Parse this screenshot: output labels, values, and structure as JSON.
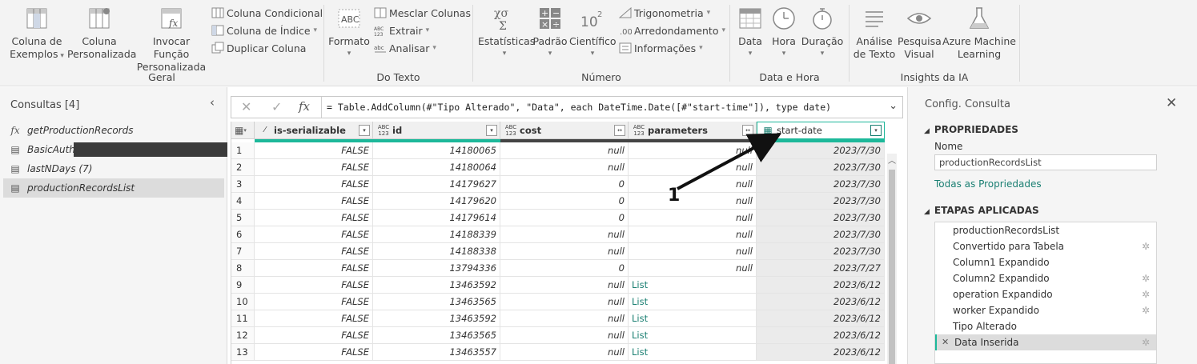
{
  "ribbon": {
    "groups": {
      "geral": "Geral",
      "texto": "Do Texto",
      "numero": "Número",
      "datahora": "Data e Hora",
      "ia": "Insights da IA"
    },
    "buttons": {
      "coluna_exemplos_1": "Coluna de",
      "coluna_exemplos_2": "Exemplos",
      "coluna_personalizada_1": "Coluna",
      "coluna_personalizada_2": "Personalizada",
      "invocar_1": "Invocar Função",
      "invocar_2": "Personalizada",
      "coluna_condicional": "Coluna Condicional",
      "coluna_indice": "Coluna de Índice",
      "duplicar_coluna": "Duplicar Coluna",
      "formato": "Formato",
      "mesclar": "Mesclar Colunas",
      "extrair": "Extrair",
      "analisar": "Analisar",
      "estatisticas": "Estatísticas",
      "padrao": "Padrão",
      "cientifico": "Científico",
      "trigonometria": "Trigonometria",
      "arredondamento": "Arredondamento",
      "informacoes": "Informações",
      "data": "Data",
      "hora": "Hora",
      "duracao": "Duração",
      "analise_texto_1": "Análise",
      "analise_texto_2": "de Texto",
      "pesquisa_visual_1": "Pesquisa",
      "pesquisa_visual_2": "Visual",
      "azure_1": "Azure Machine",
      "azure_2": "Learning"
    }
  },
  "queries": {
    "title": "Consultas [4]",
    "items": [
      {
        "label": "getProductionRecords",
        "icon": "fx"
      },
      {
        "label": "BasicAuth",
        "icon": "table"
      },
      {
        "label": "lastNDays (7)",
        "icon": "table"
      },
      {
        "label": "productionRecordsList",
        "icon": "table"
      }
    ]
  },
  "formula": {
    "text": "= Table.AddColumn(#\"Tipo Alterado\", \"Data\", each DateTime.Date([#\"start-time\"]), type date)",
    "cancel": "✕",
    "confirm": "✓",
    "fx": "fx"
  },
  "grid": {
    "columns": [
      {
        "type": "",
        "name": "is-serializable"
      },
      {
        "type": "ABC 123",
        "name": "id"
      },
      {
        "type": "ABC 123",
        "name": "cost"
      },
      {
        "type": "ABC 123",
        "name": "parameters"
      },
      {
        "type": "",
        "name": "start-date"
      }
    ],
    "rows": [
      {
        "n": "1",
        "ser": "FALSE",
        "id": "14180065",
        "cost": "null",
        "params": "null",
        "date": "2023/7/30"
      },
      {
        "n": "2",
        "ser": "FALSE",
        "id": "14180064",
        "cost": "null",
        "params": "null",
        "date": "2023/7/30"
      },
      {
        "n": "3",
        "ser": "FALSE",
        "id": "14179627",
        "cost": "0",
        "params": "null",
        "date": "2023/7/30"
      },
      {
        "n": "4",
        "ser": "FALSE",
        "id": "14179620",
        "cost": "0",
        "params": "null",
        "date": "2023/7/30"
      },
      {
        "n": "5",
        "ser": "FALSE",
        "id": "14179614",
        "cost": "0",
        "params": "null",
        "date": "2023/7/30"
      },
      {
        "n": "6",
        "ser": "FALSE",
        "id": "14188339",
        "cost": "null",
        "params": "null",
        "date": "2023/7/30"
      },
      {
        "n": "7",
        "ser": "FALSE",
        "id": "14188338",
        "cost": "null",
        "params": "null",
        "date": "2023/7/30"
      },
      {
        "n": "8",
        "ser": "FALSE",
        "id": "13794336",
        "cost": "0",
        "params": "null",
        "date": "2023/7/27"
      },
      {
        "n": "9",
        "ser": "FALSE",
        "id": "13463592",
        "cost": "null",
        "params": "List",
        "date": "2023/6/12"
      },
      {
        "n": "10",
        "ser": "FALSE",
        "id": "13463565",
        "cost": "null",
        "params": "List",
        "date": "2023/6/12"
      },
      {
        "n": "11",
        "ser": "FALSE",
        "id": "13463592",
        "cost": "null",
        "params": "List",
        "date": "2023/6/12"
      },
      {
        "n": "12",
        "ser": "FALSE",
        "id": "13463565",
        "cost": "null",
        "params": "List",
        "date": "2023/6/12"
      },
      {
        "n": "13",
        "ser": "FALSE",
        "id": "13463557",
        "cost": "null",
        "params": "List",
        "date": "2023/6/12"
      }
    ]
  },
  "settings": {
    "title": "Config. Consulta",
    "properties_heading": "PROPRIEDADES",
    "name_label": "Nome",
    "name_value": "productionRecordsList",
    "all_properties": "Todas as Propriedades",
    "steps_heading": "ETAPAS APLICADAS",
    "steps": [
      {
        "label": "productionRecordsList",
        "gear": false
      },
      {
        "label": "Convertido para Tabela",
        "gear": true
      },
      {
        "label": "Column1 Expandido",
        "gear": false
      },
      {
        "label": "Column2 Expandido",
        "gear": true
      },
      {
        "label": "operation Expandido",
        "gear": true
      },
      {
        "label": "worker Expandido",
        "gear": true
      },
      {
        "label": "Tipo Alterado",
        "gear": false
      },
      {
        "label": "Data Inserida",
        "gear": true,
        "selected": true
      }
    ]
  },
  "annotation": {
    "number": "1"
  },
  "colors": {
    "accent": "#1db89a",
    "link": "#1a7f72"
  }
}
